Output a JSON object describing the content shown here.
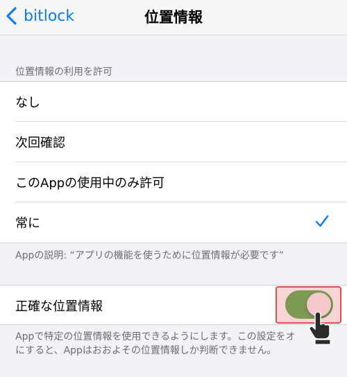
{
  "nav": {
    "back_label": "bitlock",
    "title": "位置情報"
  },
  "access": {
    "header": "位置情報の利用を許可",
    "options": [
      {
        "label": "なし",
        "selected": false
      },
      {
        "label": "次回確認",
        "selected": false
      },
      {
        "label": "このAppの使用中のみ許可",
        "selected": false
      },
      {
        "label": "常に",
        "selected": true
      }
    ],
    "footer": "Appの説明: “アプリの機能を使うために位置情報が必要です”"
  },
  "precise": {
    "label": "正確な位置情報",
    "enabled": true,
    "footer_line1": "Appで特定の位置情報を使用できるようにします。この設定をオ",
    "footer_line2": "にすると、Appはおおよその位置情報しか判断できません。"
  },
  "colors": {
    "accent": "#0a7aff",
    "toggle_on": "#7c9a52",
    "highlight_border": "#e04b54",
    "highlight_fill": "#f7d4d6"
  },
  "icons": {
    "back": "chevron-left-icon",
    "check": "checkmark-icon",
    "cursor": "hand-pointer-icon"
  }
}
